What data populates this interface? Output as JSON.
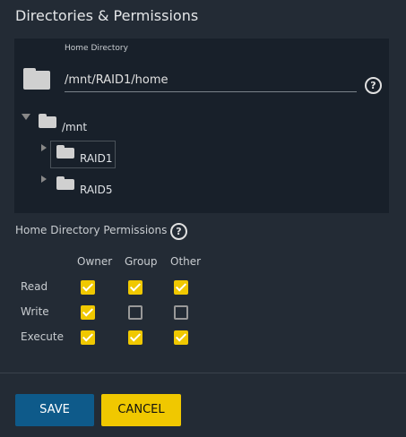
{
  "title": "Directories & Permissions",
  "home_directory": {
    "label": "Home Directory",
    "value": "/mnt/RAID1/home"
  },
  "tree": {
    "root": "/mnt",
    "children": [
      "RAID1",
      "RAID5"
    ],
    "selected": "RAID1"
  },
  "permissions": {
    "label": "Home Directory Permissions",
    "columns": [
      "Owner",
      "Group",
      "Other"
    ],
    "rows": [
      {
        "label": "Read",
        "values": [
          true,
          true,
          true
        ]
      },
      {
        "label": "Write",
        "values": [
          true,
          false,
          false
        ]
      },
      {
        "label": "Execute",
        "values": [
          true,
          true,
          true
        ]
      }
    ]
  },
  "buttons": {
    "save": "SAVE",
    "cancel": "CANCEL"
  },
  "colors": {
    "save": "#0e5a8a",
    "cancel": "#f0c800",
    "check": "#f0c800"
  }
}
